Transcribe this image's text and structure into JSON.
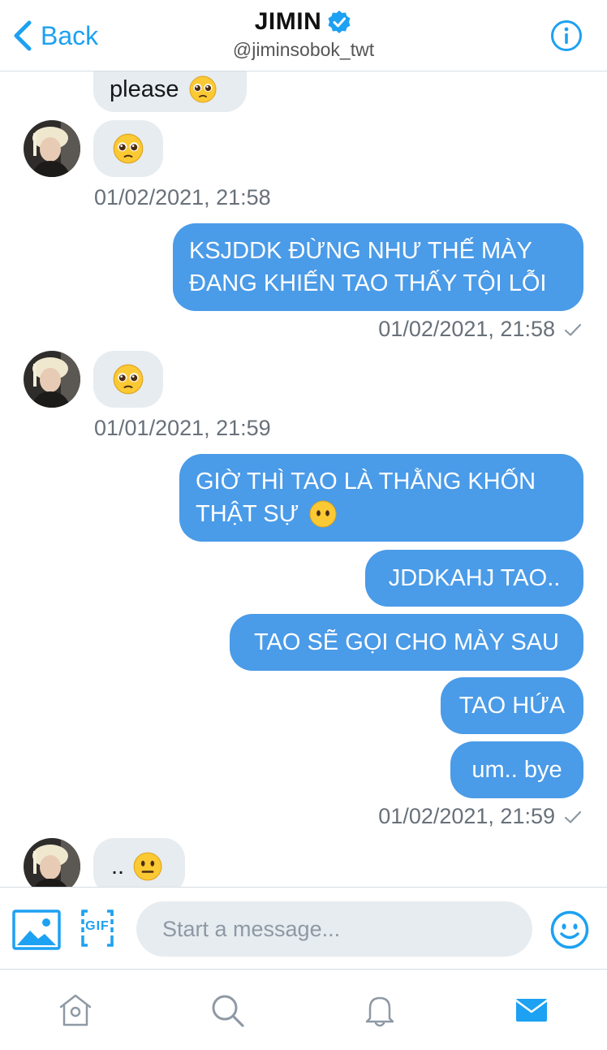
{
  "header": {
    "back_label": "Back",
    "name": "JIMIN",
    "handle": "@jiminsobok_twt"
  },
  "messages": {
    "m1_text": "please",
    "ts1": "01/02/2021, 21:58",
    "m3_line1": "KSJDDK ĐỪNG NHƯ THẾ MÀY",
    "m3_line2": "ĐANG KHIẾN TAO THẤY TỘI LỖI",
    "ts2": "01/02/2021, 21:58",
    "ts3": "01/01/2021, 21:59",
    "m5_line1": "GIỜ THÌ TAO LÀ THẰNG KHỐN",
    "m5_line2": "THẬT SỰ",
    "m6_text": "JDDKAHJ TAO..",
    "m7_text": "TAO SẼ GỌI CHO MÀY SAU",
    "m8_text": "TAO HỨA",
    "m9_text": "um.. bye",
    "ts4": "01/02/2021, 21:59",
    "m10_text": ".."
  },
  "composer": {
    "placeholder": "Start a message...",
    "gif_label": "GIF"
  },
  "icons": {
    "back": "chevron-left-icon",
    "verified": "verified-badge-icon",
    "info": "info-icon",
    "pleading": "pleading-face-emoji",
    "neutral": "neutral-face-emoji",
    "no_mouth": "face-without-mouth-emoji",
    "media": "image-icon",
    "gif": "gif-icon",
    "emoji": "smiley-icon",
    "home": "home-icon",
    "search": "search-icon",
    "notifications": "bell-icon",
    "messages": "envelope-icon"
  },
  "colors": {
    "accent": "#1da1f2",
    "outgoing_bubble": "#4a9be8",
    "incoming_bubble": "#e6ecf0",
    "timestamp": "#68707a"
  }
}
